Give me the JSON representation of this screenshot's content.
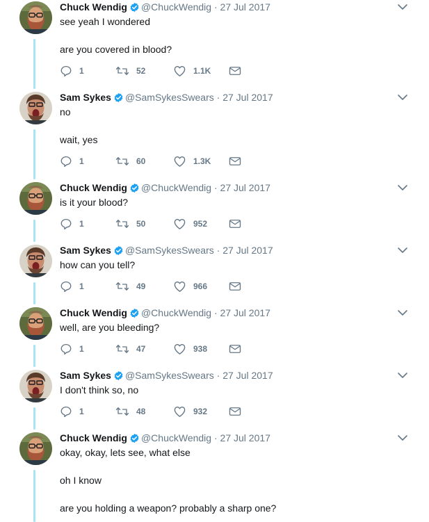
{
  "tweets": [
    {
      "author": "chuck",
      "name": "Chuck Wendig",
      "handle": "@ChuckWendig",
      "date": "27 Jul 2017",
      "paragraphs": [
        "see yeah I wondered",
        "are you covered in blood?"
      ],
      "replies": "1",
      "retweets": "52",
      "likes": "1.1K"
    },
    {
      "author": "sam",
      "name": "Sam Sykes",
      "handle": "@SamSykesSwears",
      "date": "27 Jul 2017",
      "paragraphs": [
        "no",
        "wait, yes"
      ],
      "replies": "1",
      "retweets": "60",
      "likes": "1.3K"
    },
    {
      "author": "chuck",
      "name": "Chuck Wendig",
      "handle": "@ChuckWendig",
      "date": "27 Jul 2017",
      "paragraphs": [
        "is it your blood?"
      ],
      "replies": "1",
      "retweets": "50",
      "likes": "952"
    },
    {
      "author": "sam",
      "name": "Sam Sykes",
      "handle": "@SamSykesSwears",
      "date": "27 Jul 2017",
      "paragraphs": [
        "how can you tell?"
      ],
      "replies": "1",
      "retweets": "49",
      "likes": "966"
    },
    {
      "author": "chuck",
      "name": "Chuck Wendig",
      "handle": "@ChuckWendig",
      "date": "27 Jul 2017",
      "paragraphs": [
        "well, are you bleeding?"
      ],
      "replies": "1",
      "retweets": "47",
      "likes": "938"
    },
    {
      "author": "sam",
      "name": "Sam Sykes",
      "handle": "@SamSykesSwears",
      "date": "27 Jul 2017",
      "paragraphs": [
        "I don't think so, no"
      ],
      "replies": "1",
      "retweets": "48",
      "likes": "932"
    },
    {
      "author": "chuck",
      "name": "Chuck Wendig",
      "handle": "@ChuckWendig",
      "date": "27 Jul 2017",
      "paragraphs": [
        "okay, okay, lets see, what else",
        "oh I know",
        "are you holding a weapon? probably a sharp one?"
      ],
      "replies": "",
      "retweets": "",
      "likes": ""
    }
  ],
  "icons": {
    "verified": "verified-badge-icon",
    "more": "chevron-down-icon",
    "reply": "reply-icon",
    "retweet": "retweet-icon",
    "like": "heart-icon",
    "dm": "envelope-icon"
  },
  "colors": {
    "accent": "#1da1f2",
    "thread_line": "#a5e6f2",
    "muted": "#657786",
    "text": "#14171a"
  }
}
